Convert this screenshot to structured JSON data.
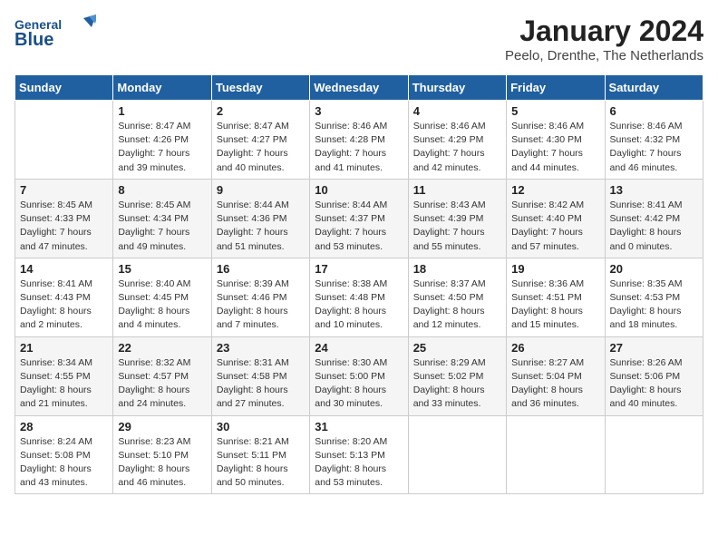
{
  "header": {
    "logo_general": "General",
    "logo_blue": "Blue",
    "month_title": "January 2024",
    "location": "Peelo, Drenthe, The Netherlands"
  },
  "weekdays": [
    "Sunday",
    "Monday",
    "Tuesday",
    "Wednesday",
    "Thursday",
    "Friday",
    "Saturday"
  ],
  "weeks": [
    [
      {
        "day": "",
        "info": ""
      },
      {
        "day": "1",
        "info": "Sunrise: 8:47 AM\nSunset: 4:26 PM\nDaylight: 7 hours\nand 39 minutes."
      },
      {
        "day": "2",
        "info": "Sunrise: 8:47 AM\nSunset: 4:27 PM\nDaylight: 7 hours\nand 40 minutes."
      },
      {
        "day": "3",
        "info": "Sunrise: 8:46 AM\nSunset: 4:28 PM\nDaylight: 7 hours\nand 41 minutes."
      },
      {
        "day": "4",
        "info": "Sunrise: 8:46 AM\nSunset: 4:29 PM\nDaylight: 7 hours\nand 42 minutes."
      },
      {
        "day": "5",
        "info": "Sunrise: 8:46 AM\nSunset: 4:30 PM\nDaylight: 7 hours\nand 44 minutes."
      },
      {
        "day": "6",
        "info": "Sunrise: 8:46 AM\nSunset: 4:32 PM\nDaylight: 7 hours\nand 46 minutes."
      }
    ],
    [
      {
        "day": "7",
        "info": "Sunrise: 8:45 AM\nSunset: 4:33 PM\nDaylight: 7 hours\nand 47 minutes."
      },
      {
        "day": "8",
        "info": "Sunrise: 8:45 AM\nSunset: 4:34 PM\nDaylight: 7 hours\nand 49 minutes."
      },
      {
        "day": "9",
        "info": "Sunrise: 8:44 AM\nSunset: 4:36 PM\nDaylight: 7 hours\nand 51 minutes."
      },
      {
        "day": "10",
        "info": "Sunrise: 8:44 AM\nSunset: 4:37 PM\nDaylight: 7 hours\nand 53 minutes."
      },
      {
        "day": "11",
        "info": "Sunrise: 8:43 AM\nSunset: 4:39 PM\nDaylight: 7 hours\nand 55 minutes."
      },
      {
        "day": "12",
        "info": "Sunrise: 8:42 AM\nSunset: 4:40 PM\nDaylight: 7 hours\nand 57 minutes."
      },
      {
        "day": "13",
        "info": "Sunrise: 8:41 AM\nSunset: 4:42 PM\nDaylight: 8 hours\nand 0 minutes."
      }
    ],
    [
      {
        "day": "14",
        "info": "Sunrise: 8:41 AM\nSunset: 4:43 PM\nDaylight: 8 hours\nand 2 minutes."
      },
      {
        "day": "15",
        "info": "Sunrise: 8:40 AM\nSunset: 4:45 PM\nDaylight: 8 hours\nand 4 minutes."
      },
      {
        "day": "16",
        "info": "Sunrise: 8:39 AM\nSunset: 4:46 PM\nDaylight: 8 hours\nand 7 minutes."
      },
      {
        "day": "17",
        "info": "Sunrise: 8:38 AM\nSunset: 4:48 PM\nDaylight: 8 hours\nand 10 minutes."
      },
      {
        "day": "18",
        "info": "Sunrise: 8:37 AM\nSunset: 4:50 PM\nDaylight: 8 hours\nand 12 minutes."
      },
      {
        "day": "19",
        "info": "Sunrise: 8:36 AM\nSunset: 4:51 PM\nDaylight: 8 hours\nand 15 minutes."
      },
      {
        "day": "20",
        "info": "Sunrise: 8:35 AM\nSunset: 4:53 PM\nDaylight: 8 hours\nand 18 minutes."
      }
    ],
    [
      {
        "day": "21",
        "info": "Sunrise: 8:34 AM\nSunset: 4:55 PM\nDaylight: 8 hours\nand 21 minutes."
      },
      {
        "day": "22",
        "info": "Sunrise: 8:32 AM\nSunset: 4:57 PM\nDaylight: 8 hours\nand 24 minutes."
      },
      {
        "day": "23",
        "info": "Sunrise: 8:31 AM\nSunset: 4:58 PM\nDaylight: 8 hours\nand 27 minutes."
      },
      {
        "day": "24",
        "info": "Sunrise: 8:30 AM\nSunset: 5:00 PM\nDaylight: 8 hours\nand 30 minutes."
      },
      {
        "day": "25",
        "info": "Sunrise: 8:29 AM\nSunset: 5:02 PM\nDaylight: 8 hours\nand 33 minutes."
      },
      {
        "day": "26",
        "info": "Sunrise: 8:27 AM\nSunset: 5:04 PM\nDaylight: 8 hours\nand 36 minutes."
      },
      {
        "day": "27",
        "info": "Sunrise: 8:26 AM\nSunset: 5:06 PM\nDaylight: 8 hours\nand 40 minutes."
      }
    ],
    [
      {
        "day": "28",
        "info": "Sunrise: 8:24 AM\nSunset: 5:08 PM\nDaylight: 8 hours\nand 43 minutes."
      },
      {
        "day": "29",
        "info": "Sunrise: 8:23 AM\nSunset: 5:10 PM\nDaylight: 8 hours\nand 46 minutes."
      },
      {
        "day": "30",
        "info": "Sunrise: 8:21 AM\nSunset: 5:11 PM\nDaylight: 8 hours\nand 50 minutes."
      },
      {
        "day": "31",
        "info": "Sunrise: 8:20 AM\nSunset: 5:13 PM\nDaylight: 8 hours\nand 53 minutes."
      },
      {
        "day": "",
        "info": ""
      },
      {
        "day": "",
        "info": ""
      },
      {
        "day": "",
        "info": ""
      }
    ]
  ]
}
